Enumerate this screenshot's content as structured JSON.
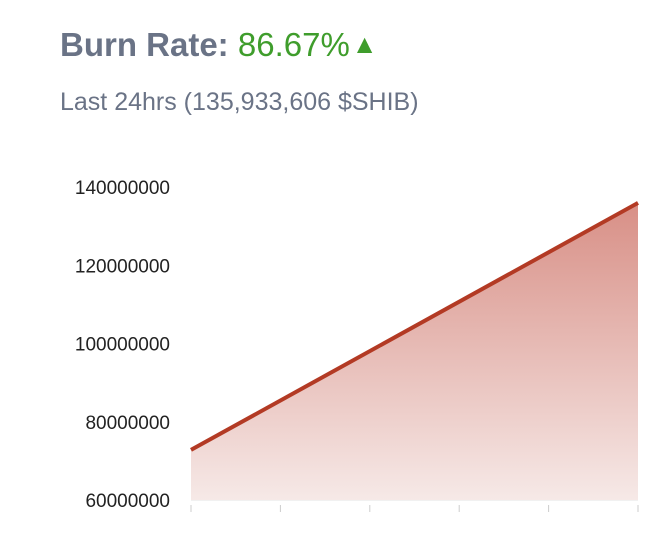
{
  "header": {
    "title_label": "Burn Rate:",
    "title_value": "86.67%",
    "trend_icon": "up-triangle-icon",
    "subtitle": "Last 24hrs (135,933,606 $SHIB)"
  },
  "colors": {
    "title": "#6a7386",
    "positive": "#3f9d2c",
    "line": "#b33a24",
    "area_top": "#d88f86",
    "area_bottom": "#f6e9e7"
  },
  "chart_data": {
    "type": "area",
    "x": [
      0,
      1
    ],
    "series": [
      {
        "values": [
          72800000,
          135933606
        ]
      }
    ],
    "yticks": [
      "140000000",
      "120000000",
      "100000000",
      "80000000",
      "60000000"
    ],
    "ylim": [
      60000000,
      140000000
    ],
    "xtick_count": 6,
    "grid": false,
    "legend": "none"
  }
}
